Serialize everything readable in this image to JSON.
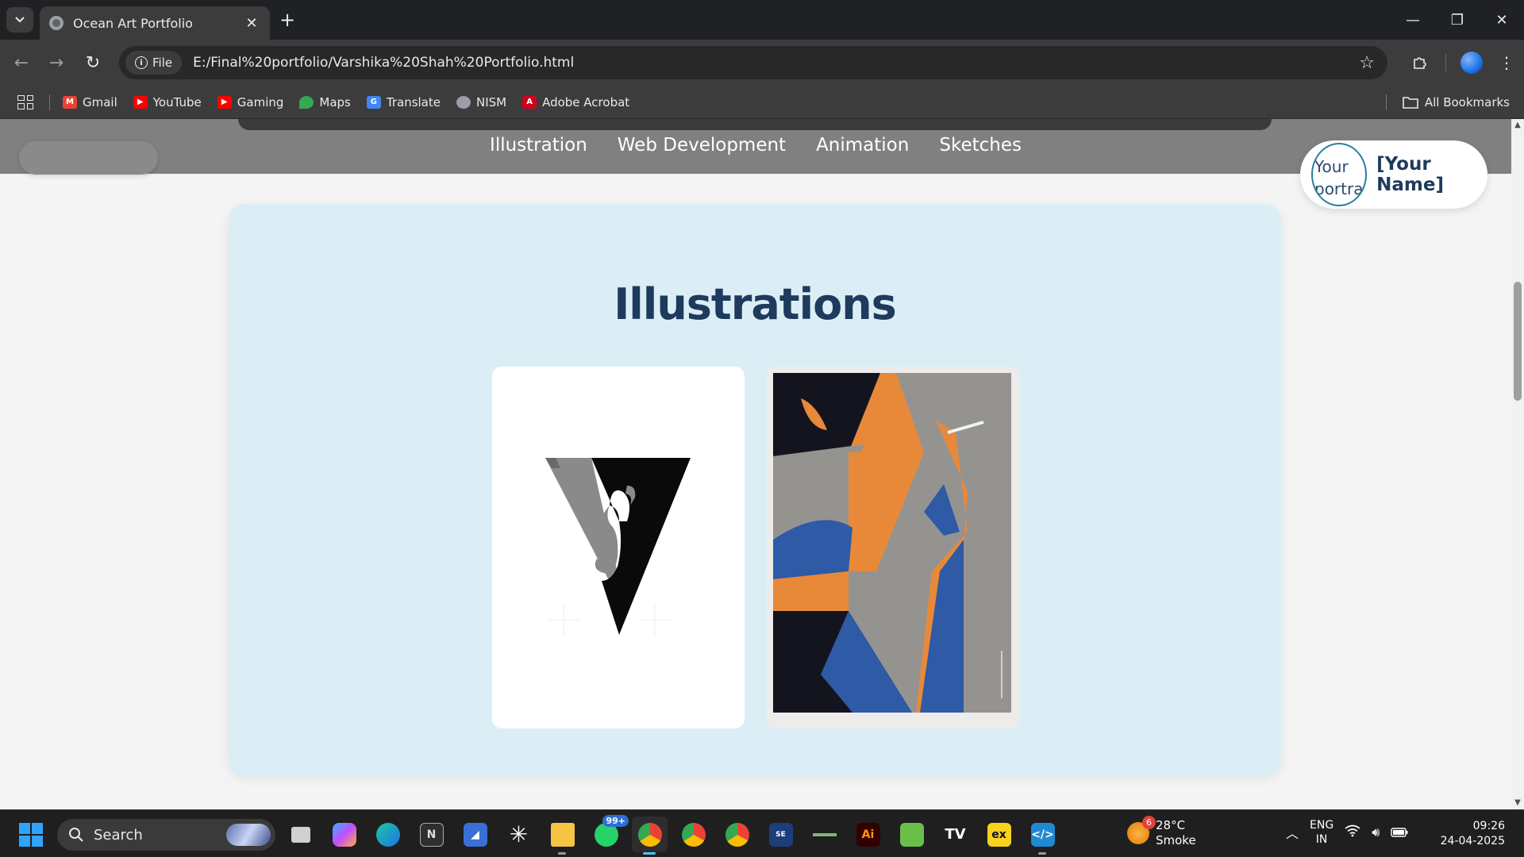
{
  "browser": {
    "tab_title": "Ocean Art Portfolio",
    "file_chip": "File",
    "url": "E:/Final%20portfolio/Varshika%20Shah%20Portfolio.html",
    "bookmarks": [
      {
        "label": "Gmail",
        "color": "#ea4335",
        "icon": "gmail-icon"
      },
      {
        "label": "YouTube",
        "color": "#ff0000",
        "icon": "youtube-icon"
      },
      {
        "label": "Gaming",
        "color": "#ff0000",
        "icon": "youtube-gaming-icon"
      },
      {
        "label": "Maps",
        "color": "#34a853",
        "icon": "maps-icon"
      },
      {
        "label": "Translate",
        "color": "#4285f4",
        "icon": "translate-icon"
      },
      {
        "label": "NISM",
        "color": "#9aa0a6",
        "icon": "globe-icon"
      },
      {
        "label": "Adobe Acrobat",
        "color": "#d0021b",
        "icon": "acrobat-icon"
      }
    ],
    "all_bookmarks": "All Bookmarks"
  },
  "site": {
    "nav": [
      "Illustration",
      "Web Development",
      "Animation",
      "Sketches"
    ],
    "avatar_alt": "Your portrait",
    "name": "[Your Name]",
    "section_title": "Illustrations"
  },
  "taskbar": {
    "search_placeholder": "Search",
    "whatsapp_badge": "99+",
    "weather_badge": "6",
    "temperature": "28°C",
    "condition": "Smoke",
    "lang_line1": "ENG",
    "lang_line2": "IN",
    "time": "09:26",
    "date": "24-04-2025"
  },
  "colors": {
    "accent": "#1e3a5c",
    "gallery_bg": "#dbeef6",
    "nav_bg": "#808080"
  }
}
